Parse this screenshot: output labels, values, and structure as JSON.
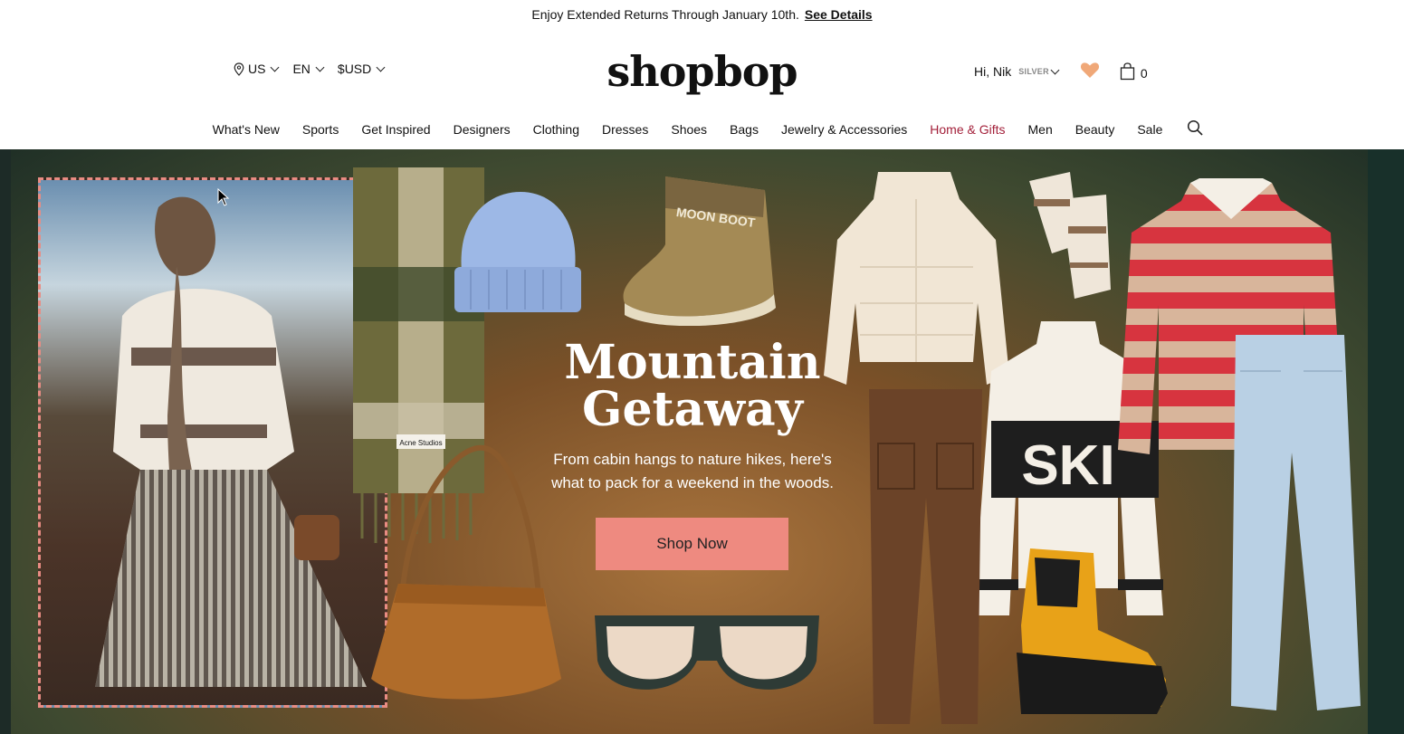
{
  "promo": {
    "text": "Enjoy Extended Returns Through January 10th.",
    "link": "See Details"
  },
  "utility": {
    "country": "US",
    "language": "EN",
    "currency": "$USD"
  },
  "logo": "shopbop",
  "account": {
    "greeting": "Hi, Nik",
    "tier": "SILVER",
    "bag_count": "0"
  },
  "nav": {
    "items": [
      "What's New",
      "Sports",
      "Get Inspired",
      "Designers",
      "Clothing",
      "Dresses",
      "Shoes",
      "Bags",
      "Jewelry & Accessories",
      "Home & Gifts",
      "Men",
      "Beauty",
      "Sale"
    ]
  },
  "hero": {
    "headline_line1": "Mountain",
    "headline_line2": "Getaway",
    "subline_line1": "From cabin hangs to nature hikes, here's",
    "subline_line2": "what to pack for a weekend in the woods.",
    "cta": "Shop Now",
    "scarf_tag": "Acne Studios",
    "boot_text": "MOON BOOT",
    "sweater_text": "SKI"
  },
  "colors": {
    "accent": "#ee8a80",
    "highlight_nav": "#a3203a",
    "heart": "#f0a878"
  }
}
